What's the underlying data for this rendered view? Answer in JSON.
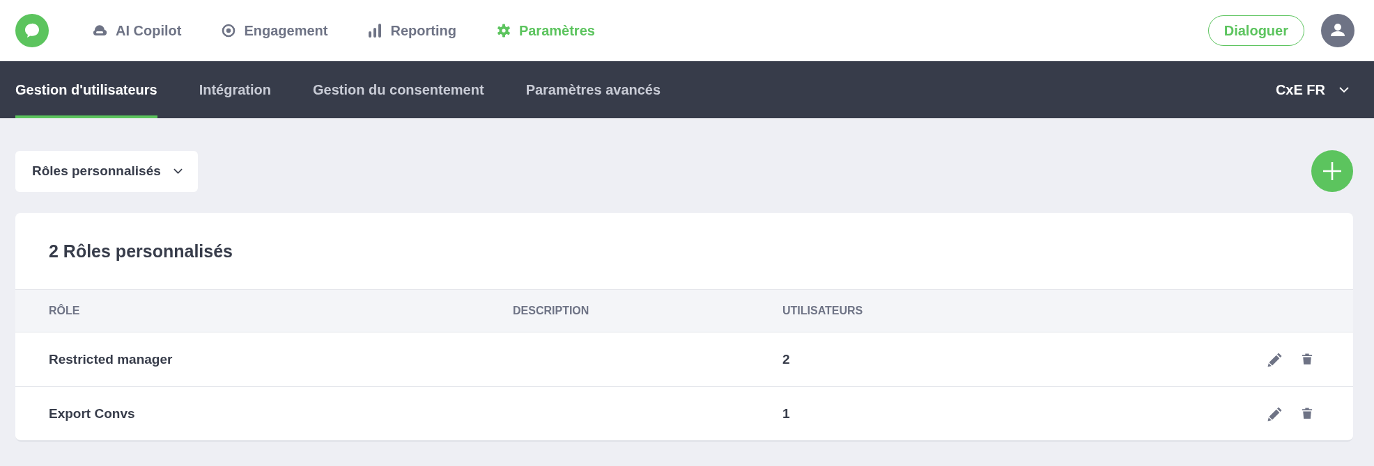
{
  "top_nav": {
    "items": [
      {
        "label": "AI Copilot",
        "selected": false
      },
      {
        "label": "Engagement",
        "selected": false
      },
      {
        "label": "Reporting",
        "selected": false
      },
      {
        "label": "Paramètres",
        "selected": true
      }
    ],
    "action_button": "Dialoguer"
  },
  "tabs": [
    {
      "label": "Gestion d'utilisateurs",
      "selected": true
    },
    {
      "label": "Intégration",
      "selected": false
    },
    {
      "label": "Gestion du consentement",
      "selected": false
    },
    {
      "label": "Paramètres avancés",
      "selected": false
    }
  ],
  "workspace_selector": "CxE FR",
  "filter_dropdown": "Rôles personnalisés",
  "table": {
    "title": "2 Rôles personnalisés",
    "columns": [
      "RÔLE",
      "DESCRIPTION",
      "UTILISATEURS"
    ],
    "rows": [
      {
        "role": "Restricted manager",
        "description": "",
        "users": "2"
      },
      {
        "role": "Export Convs",
        "description": "",
        "users": "1"
      }
    ]
  }
}
